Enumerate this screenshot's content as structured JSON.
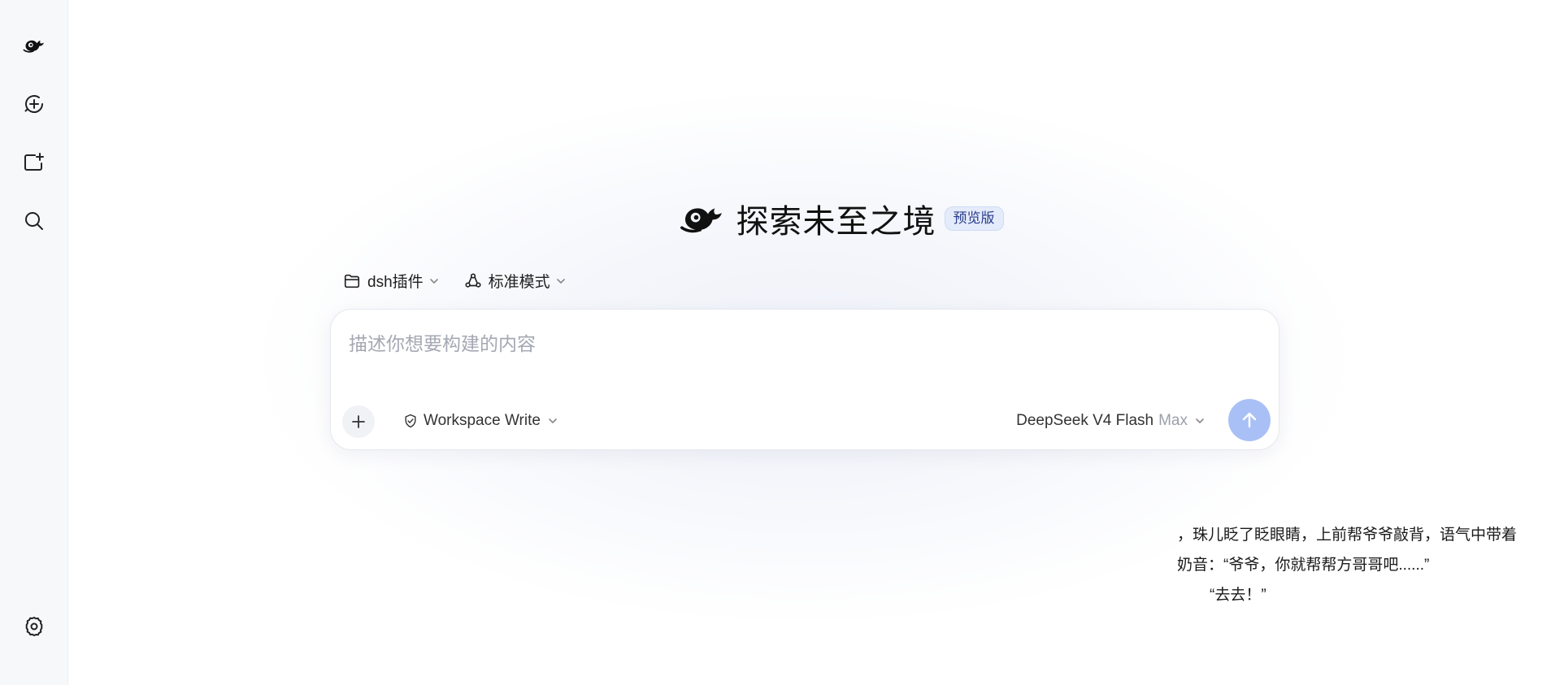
{
  "sidebar": {
    "items": [
      {
        "name": "logo",
        "icon": "whale-logo-icon"
      },
      {
        "name": "new-chat",
        "icon": "plus-circle-icon"
      },
      {
        "name": "new-project",
        "icon": "folder-plus-icon"
      },
      {
        "name": "search",
        "icon": "search-icon"
      }
    ],
    "settings_icon": "gear-icon"
  },
  "hero": {
    "title": "探索未至之境",
    "badge": "预览版"
  },
  "selectors": {
    "project": "dsh插件",
    "mode": "标准模式"
  },
  "composer": {
    "placeholder": "描述你想要构建的内容",
    "permission": "Workspace Write",
    "model": "DeepSeek V4 Flash",
    "model_tier": "Max"
  },
  "story": {
    "line1": "，珠儿眨了眨眼睛，上前帮爷爷敲背，语气中带着",
    "line2": "奶音：“爷爷，你就帮帮方哥哥吧......”",
    "line3": "“去去！”"
  },
  "colors": {
    "accent": "#a9c0f6",
    "badge_bg": "#e4ebfb",
    "badge_text": "#2a3c8c",
    "sidebar_bg": "#f7f8fa"
  }
}
